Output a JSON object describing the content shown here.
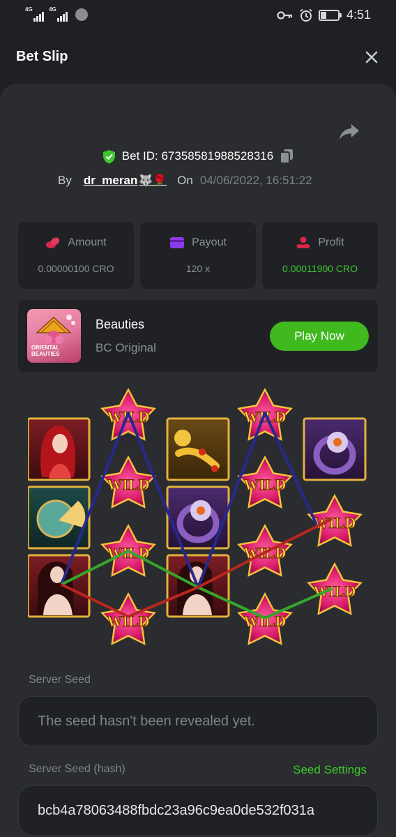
{
  "status_bar": {
    "signal1_label": "4G",
    "signal2_label": "4G",
    "time": "4:51",
    "battery_level": 0.35
  },
  "header": {
    "title": "Bet Slip"
  },
  "bet": {
    "id_label": "Bet ID: 67358581988528316",
    "by_label": "By",
    "username": "dr_meran",
    "user_emoji": "🐺🌹",
    "on_label": "On",
    "date": "04/06/2022, 16:51:22"
  },
  "stats": {
    "amount_label": "Amount",
    "amount_value": "0.00000100 CRO",
    "payout_label": "Payout",
    "payout_value": "120 x",
    "profit_label": "Profit",
    "profit_value": "0.00011900 CRO"
  },
  "game": {
    "name": "Beauties",
    "subtitle": "BC Original",
    "play_label": "Play Now",
    "thumb_text": "ORIENTAL BEAUTIES"
  },
  "reels": {
    "columns": [
      [
        "beauty-red",
        "jade-fan",
        "beauty-nude"
      ],
      [
        "wild",
        "wild",
        "wild",
        "wild"
      ],
      [
        "golden-ruyi",
        "purple-ring",
        "beauty-nude"
      ],
      [
        "wild",
        "wild",
        "wild",
        "wild"
      ],
      [
        "purple-ring",
        "wild",
        "wild"
      ]
    ],
    "wild_text": "WILD",
    "win_line_colors": [
      "#27288f",
      "#36a52c",
      "#b8271f"
    ]
  },
  "seeds": {
    "server_seed_label": "Server Seed",
    "server_seed_value": "The seed hasn't been revealed yet.",
    "hash_label": "Server Seed (hash)",
    "seed_settings_label": "Seed Settings",
    "hash_value": "bcb4a78063488fbdc23a96c9ea0de532f031a"
  },
  "colors": {
    "background": "#1f2023",
    "panel": "#2a2c2f",
    "card": "#1f2124",
    "accent_green": "#3ec62f",
    "muted_text": "#8c9096"
  }
}
